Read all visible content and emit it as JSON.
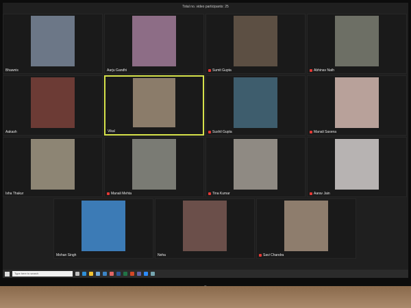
{
  "window": {
    "title": "Total no. video participants: 25"
  },
  "tiles": [
    {
      "name": "Bhawnis",
      "muted": false,
      "bg": "#6c7787",
      "active": false
    },
    {
      "name": "Aarju Gandhi",
      "muted": false,
      "bg": "#8d6d86",
      "active": false
    },
    {
      "name": "Sumit Gupta",
      "muted": true,
      "bg": "#5c4f43",
      "active": false
    },
    {
      "name": "Abhinav Nath",
      "muted": true,
      "bg": "#6d6f65",
      "active": false
    },
    {
      "name": "Aakash",
      "muted": false,
      "bg": "#6c3b35",
      "active": false
    },
    {
      "name": "Vikal",
      "muted": false,
      "bg": "#8b7c6a",
      "active": true
    },
    {
      "name": "Sushil Gupta",
      "muted": true,
      "bg": "#3e5d6d",
      "active": false
    },
    {
      "name": "Manali Saxena",
      "muted": true,
      "bg": "#b8a19a",
      "active": false
    },
    {
      "name": "Isha Thakur",
      "muted": false,
      "bg": "#8d8574",
      "active": false
    },
    {
      "name": "Manali Mehta",
      "muted": true,
      "bg": "#7a7b74",
      "active": false
    },
    {
      "name": "Tina Kumar",
      "muted": true,
      "bg": "#8f8a83",
      "active": false
    },
    {
      "name": "Aarav Jain",
      "muted": true,
      "bg": "#b7b3b2",
      "active": false
    },
    {
      "name": "Mohan Singh",
      "muted": false,
      "bg": "#3c7bb6",
      "active": false
    },
    {
      "name": "Neha",
      "muted": false,
      "bg": "#6b4f4a",
      "active": false
    },
    {
      "name": "Savi Chandra",
      "muted": true,
      "bg": "#8e7d6d",
      "active": false
    }
  ],
  "taskbar": {
    "search_placeholder": "Type here to search",
    "icons": [
      {
        "name": "task-view-icon",
        "color": "#bfbfbf"
      },
      {
        "name": "edge-icon",
        "color": "#2f8fd8"
      },
      {
        "name": "file-explorer-icon",
        "color": "#f1c232"
      },
      {
        "name": "store-icon",
        "color": "#6fa8dc"
      },
      {
        "name": "mail-icon",
        "color": "#3d85c6"
      },
      {
        "name": "chrome-icon",
        "color": "#e06666"
      },
      {
        "name": "word-icon",
        "color": "#2b579a"
      },
      {
        "name": "excel-icon",
        "color": "#217346"
      },
      {
        "name": "powerpoint-icon",
        "color": "#d24726"
      },
      {
        "name": "teams-icon",
        "color": "#6264a7"
      },
      {
        "name": "zoom-icon",
        "color": "#2d8cff"
      },
      {
        "name": "photos-icon",
        "color": "#76a5af"
      }
    ]
  },
  "monitor": {
    "brand": "hp"
  }
}
